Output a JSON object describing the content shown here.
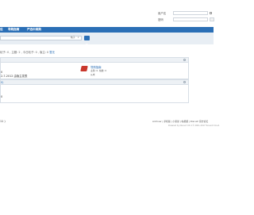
{
  "header": {
    "username_label": "用户名",
    "password_label": "密码"
  },
  "nav": {
    "items": [
      "设",
      "导购指南",
      "严选中美购"
    ]
  },
  "search": {
    "scope": "帖子",
    "placeholder": ""
  },
  "breadcrumb": {
    "parts": [
      "帖子: 0",
      "主题: 2",
      "今日帖子: 0",
      "版主: 0"
    ],
    "highlight": "暂无"
  },
  "forum_box_1": {
    "left_line1": "0",
    "left_line2": "2-7-2012 由版主发表",
    "forum_title": "导购指南",
    "forum_stats": "主题: 0, 帖数: 0",
    "forum_extra": "从未"
  },
  "forum_box_2": {
    "header_text": "0)",
    "line": "0"
  },
  "footer": {
    "left": "11 )",
    "links": [
      "Archiver",
      "手机版",
      "小黑屋",
      "帖视频",
      "Discuz! 官方论坛"
    ],
    "powered": "Powered by Discuz! X3.4  © 2001-2017 Tencent Cloud."
  }
}
